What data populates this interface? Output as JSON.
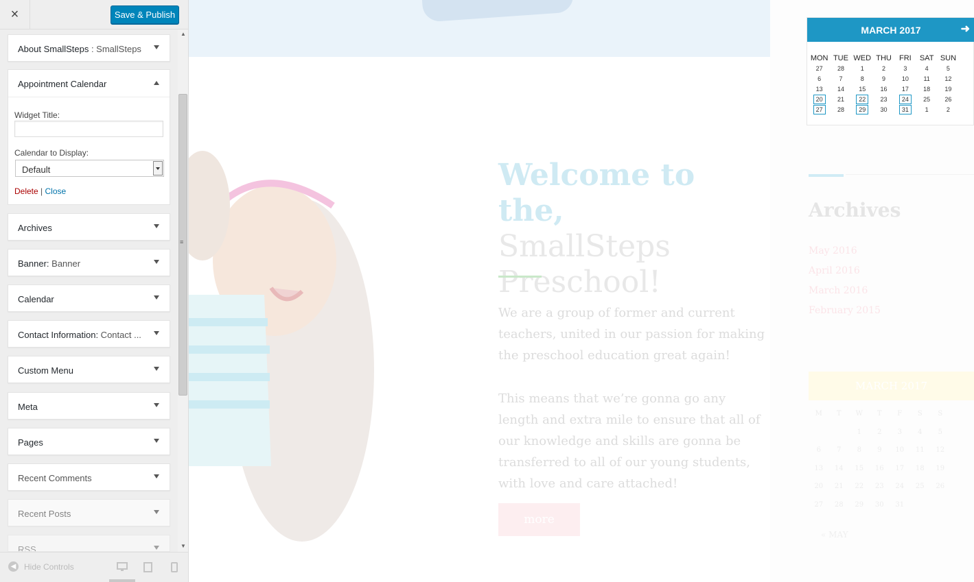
{
  "topbar": {
    "close_icon": "×",
    "save_label": "Save & Publish"
  },
  "widgets": [
    {
      "title": "About SmallSteps",
      "sub": " : SmallSteps"
    },
    {
      "title": "Archives",
      "sub": ""
    },
    {
      "title": "Banner:",
      "sub": " Banner"
    },
    {
      "title": "Calendar",
      "sub": ""
    },
    {
      "title": "Contact Information:",
      "sub": " Contact ..."
    },
    {
      "title": "Custom Menu",
      "sub": ""
    },
    {
      "title": "Meta",
      "sub": ""
    },
    {
      "title": "Pages",
      "sub": ""
    },
    {
      "title": "Recent Comments",
      "sub": ""
    },
    {
      "title": "Recent Posts",
      "sub": ""
    },
    {
      "title": "RSS",
      "sub": ""
    }
  ],
  "appointment": {
    "title": "Appointment Calendar",
    "widget_title_label": "Widget Title:",
    "widget_title_value": "",
    "calendar_label": "Calendar to Display:",
    "calendar_value": "Default",
    "delete_label": "Delete",
    "sep": " | ",
    "close_label": "Close"
  },
  "footer": {
    "hide_controls": "Hide Controls"
  },
  "preview": {
    "welcome_line1": "Welcome to the,",
    "welcome_line2": "SmallSteps",
    "welcome_line3": "Preschool!",
    "para1": "We are a group of former and current teachers, united in our passion for making the preschool education great again!",
    "para2": "This means that we’re gonna go any length and extra mile to ensure that all of our knowledge and skills are gonna be transferred to all of our young students, with love and care attached!",
    "more_label": "more"
  },
  "calendar": {
    "month": "MARCH 2017",
    "days": [
      "MON",
      "TUE",
      "WED",
      "THU",
      "FRI",
      "SAT",
      "SUN"
    ],
    "weeks": [
      [
        "27",
        "28",
        "1",
        "2",
        "3",
        "4",
        "5"
      ],
      [
        "6",
        "7",
        "8",
        "9",
        "10",
        "11",
        "12"
      ],
      [
        "13",
        "14",
        "15",
        "16",
        "17",
        "18",
        "19"
      ],
      [
        "20",
        "21",
        "22",
        "23",
        "24",
        "25",
        "26"
      ],
      [
        "27",
        "28",
        "29",
        "30",
        "31",
        "1",
        "2"
      ]
    ]
  },
  "archives": {
    "title": "Archives",
    "items": [
      "May 2016",
      "April 2016",
      "March 2016",
      "February 2015"
    ]
  },
  "faded_calendar": {
    "month": "MARCH 2017",
    "days": [
      "M",
      "T",
      "W",
      "T",
      "F",
      "S",
      "S"
    ],
    "weeks": [
      [
        "",
        "",
        "1",
        "2",
        "3",
        "4",
        "5"
      ],
      [
        "6",
        "7",
        "8",
        "9",
        "10",
        "11",
        "12"
      ],
      [
        "13",
        "14",
        "15",
        "16",
        "17",
        "18",
        "19"
      ],
      [
        "20",
        "21",
        "22",
        "23",
        "24",
        "25",
        "26"
      ],
      [
        "27",
        "28",
        "29",
        "30",
        "31",
        "",
        ""
      ]
    ],
    "prev": "« MAY"
  },
  "colors": {
    "accent": "#0085ba",
    "calendar_header": "#1e97c5",
    "delete": "#aa0000",
    "link": "#0073aa"
  }
}
